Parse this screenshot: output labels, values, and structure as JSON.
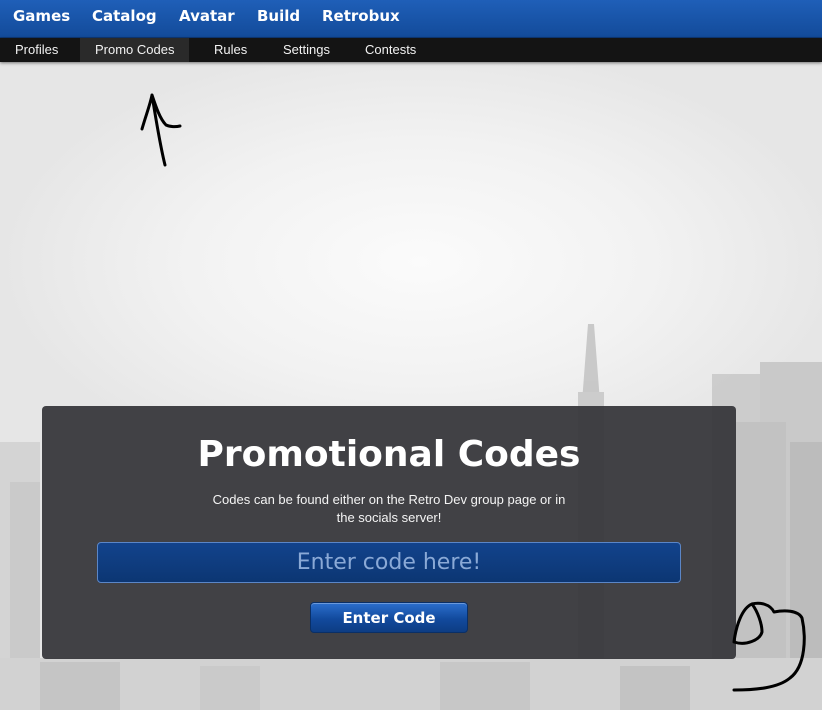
{
  "topnav": {
    "items": [
      "Games",
      "Catalog",
      "Avatar",
      "Build",
      "Retrobux"
    ]
  },
  "subnav": {
    "items": [
      "Profiles",
      "Promo Codes",
      "Rules",
      "Settings",
      "Contests"
    ],
    "active": "Promo Codes"
  },
  "promo": {
    "title": "Promotional Codes",
    "description": "Codes can be found either on the Retro Dev group page or in the socials server!",
    "input_placeholder": "Enter code here!",
    "input_value": "",
    "button_label": "Enter Code"
  },
  "colors": {
    "nav_blue": "#1a56ab",
    "subnav_dark": "#141414",
    "panel": "#343438",
    "button_blue": "#124a9d"
  }
}
